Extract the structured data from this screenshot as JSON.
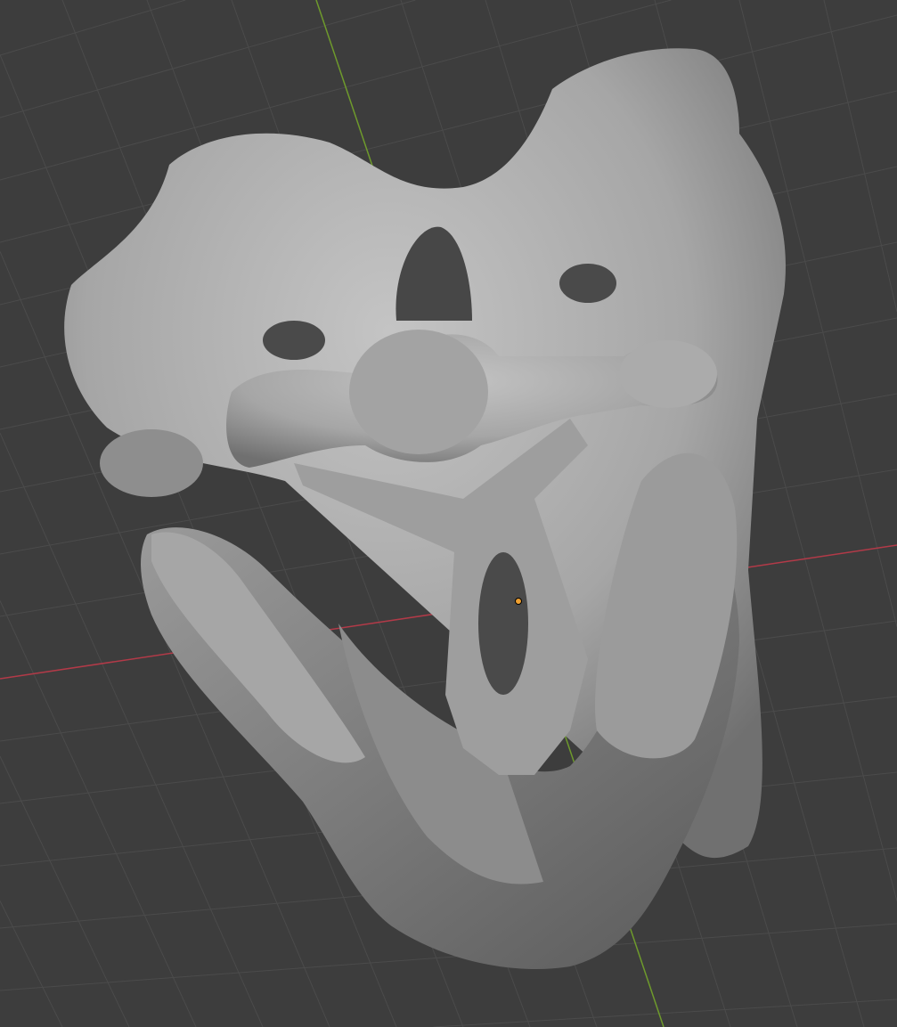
{
  "viewport": {
    "background_color": "#3d3d3d",
    "grid_color": "#4b4b4b",
    "x_axis_color": "#b23a48",
    "y_axis_color": "#6e9a2c",
    "origin_color": "#f0a030",
    "mesh_color": "#a8a8a8",
    "mesh_shadow_color": "#5e5e5e",
    "icons": [
      "origin-point-icon"
    ]
  }
}
